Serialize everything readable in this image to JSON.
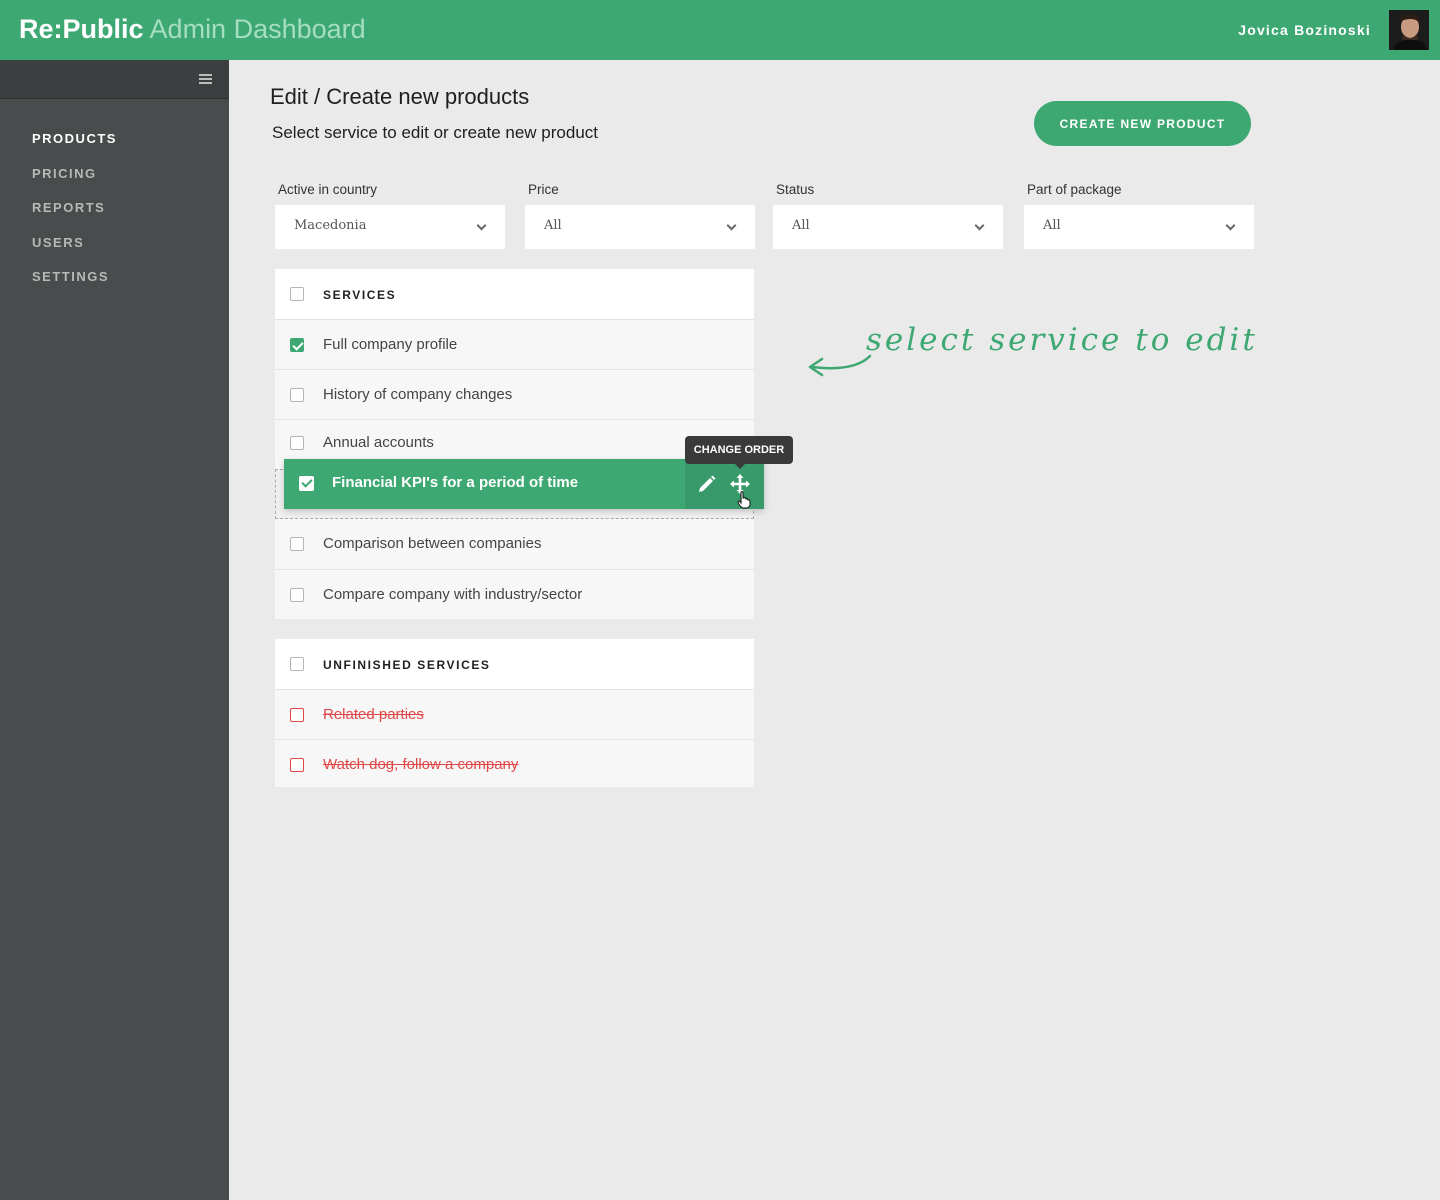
{
  "header": {
    "brand_main": "Re:Public",
    "brand_sub": "Admin Dashboard",
    "user_name": "Jovica Bozinoski",
    "avatar_icon": "user-avatar-photo"
  },
  "sidebar": {
    "menu_icon": "hamburger-icon",
    "items": [
      {
        "label": "PRODUCTS",
        "active": true
      },
      {
        "label": "PRICING",
        "active": false
      },
      {
        "label": "REPORTS",
        "active": false
      },
      {
        "label": "USERS",
        "active": false
      },
      {
        "label": "SETTINGS",
        "active": false
      }
    ]
  },
  "main": {
    "title": "Edit / Create new products",
    "subtitle": "Select service to edit or create new product",
    "create_button": "CREATE NEW PRODUCT"
  },
  "filters": [
    {
      "label": "Active in country",
      "value": "Macedonia"
    },
    {
      "label": "Price",
      "value": "All"
    },
    {
      "label": "Status",
      "value": "All"
    },
    {
      "label": "Part of package",
      "value": "All"
    }
  ],
  "services": {
    "header": "SERVICES",
    "items": [
      {
        "label": "Full company profile",
        "checked": true
      },
      {
        "label": "History of company changes",
        "checked": false
      },
      {
        "label": "Annual accounts",
        "checked": false
      },
      {
        "label": "Comparison between companies",
        "checked": false
      },
      {
        "label": "Compare company with industry/sector",
        "checked": false
      }
    ],
    "dragging": {
      "label": "Financial KPI's for a period of time",
      "checked": true,
      "tooltip": "CHANGE ORDER",
      "edit_icon": "pencil-icon",
      "move_icon": "move-arrows-icon"
    }
  },
  "unfinished": {
    "header": "UNFINISHED SERVICES",
    "items": [
      {
        "label": "Related parties"
      },
      {
        "label": "Watch dog, follow a company"
      }
    ]
  },
  "hint": "select service to edit",
  "colors": {
    "accent": "#3ea873",
    "accent_dark": "#38996a",
    "sidebar": "#484c4c",
    "danger": "#e04848",
    "background": "#eaeaea"
  }
}
